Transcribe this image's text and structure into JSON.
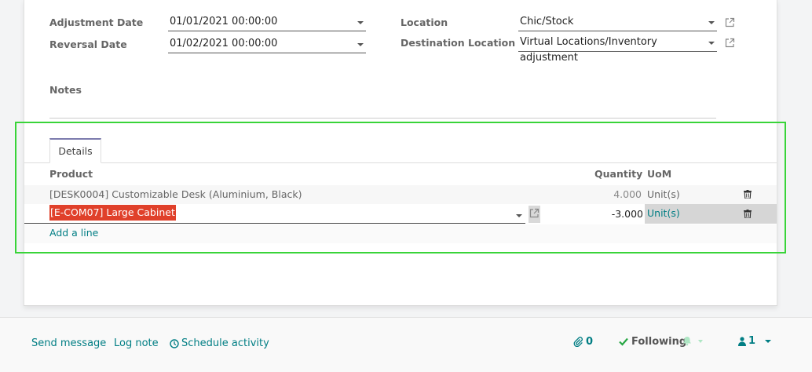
{
  "form": {
    "adjustment_date_label": "Adjustment Date",
    "adjustment_date_value": "01/01/2021 00:00:00",
    "reversal_date_label": "Reversal Date",
    "reversal_date_value": "01/02/2021 00:00:00",
    "location_label": "Location",
    "location_value": "Chic/Stock",
    "destination_label": "Destination Location",
    "destination_value": "Virtual Locations/Inventory adjustment",
    "notes_label": "Notes"
  },
  "tabs": [
    {
      "label": "Details"
    }
  ],
  "table": {
    "headers": {
      "product": "Product",
      "quantity": "Quantity",
      "uom": "UoM"
    },
    "rows": [
      {
        "product": "[DESK0004] Customizable Desk (Aluminium, Black)",
        "quantity": "4.000",
        "uom": "Unit(s)"
      },
      {
        "product": "[E-COM07] Large Cabinet",
        "quantity": "-3.000",
        "uom": "Unit(s)"
      }
    ],
    "add_line": "Add a line"
  },
  "chatter": {
    "send_message": "Send message",
    "log_note": "Log note",
    "schedule_activity": "Schedule activity",
    "attachments_count": "0",
    "following": "Following",
    "followers_count": "1"
  },
  "colors": {
    "accent": "#017e84",
    "highlight": "#e0402a",
    "annotation_box": "#39d439"
  }
}
